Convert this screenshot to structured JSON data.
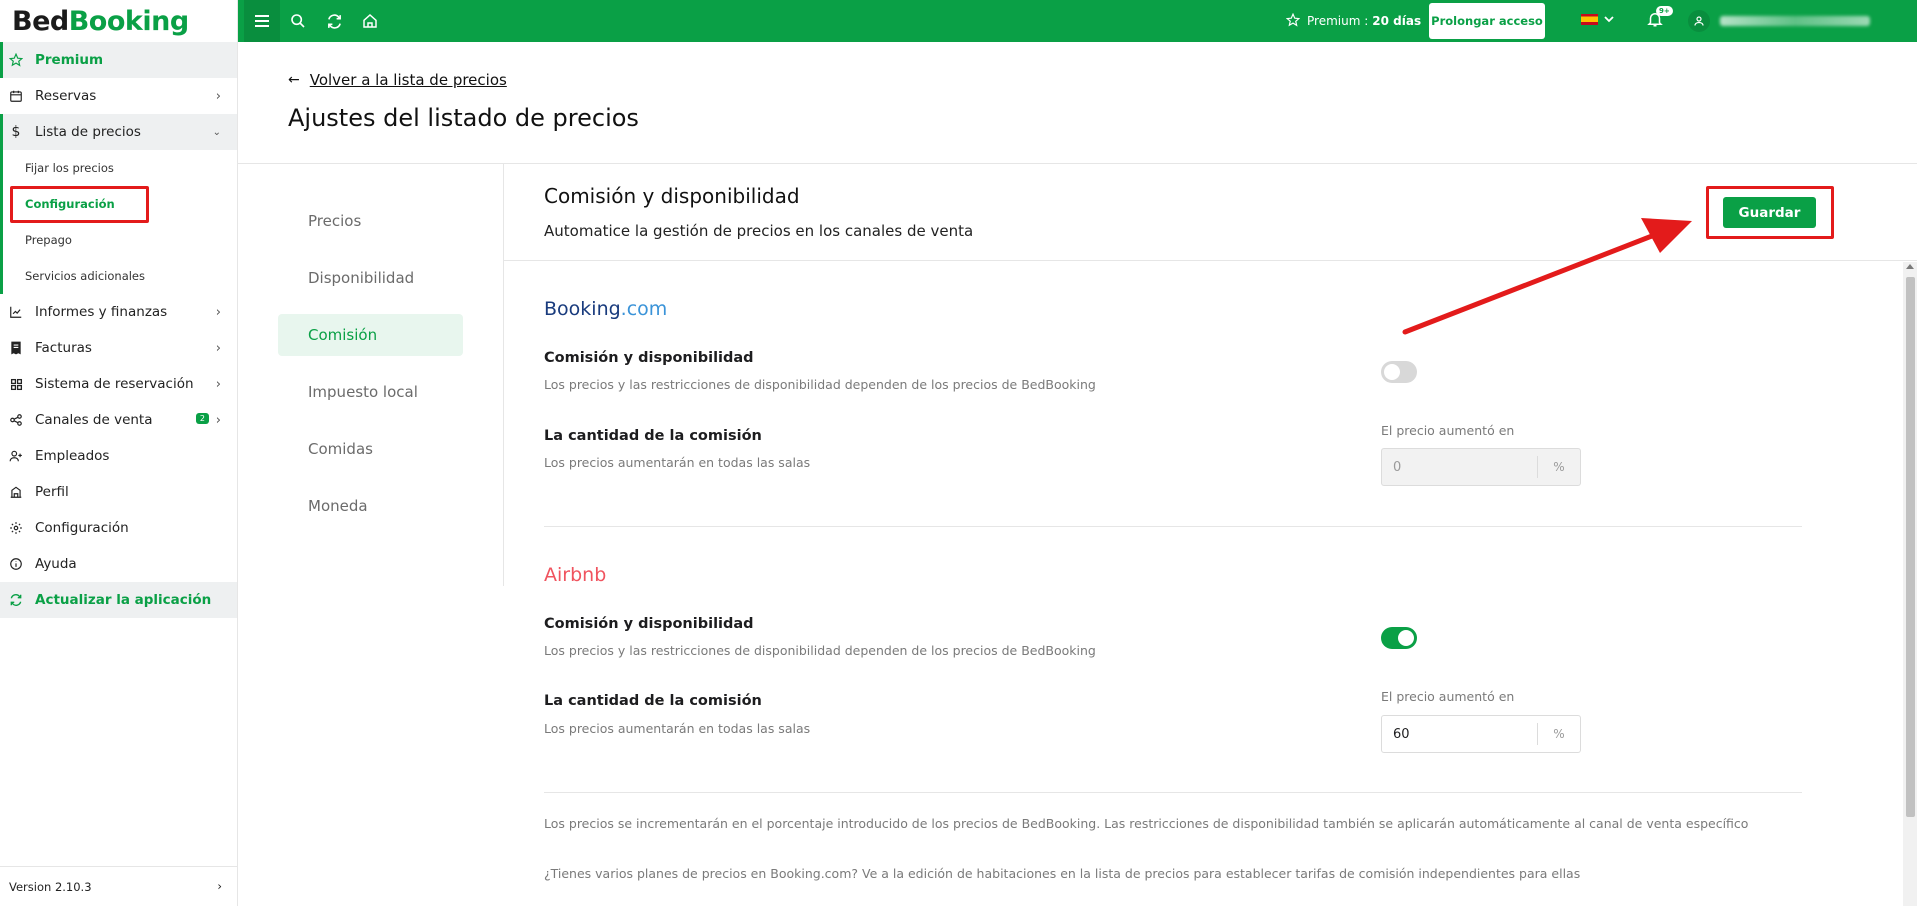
{
  "app": {
    "logo_part1": "Bed",
    "logo_part2": "Booking"
  },
  "sidebar": {
    "premium": "Premium",
    "reservas": "Reservas",
    "lista_precios": "Lista de precios",
    "sub_items": [
      "Fijar los precios",
      "Configuración",
      "Prepago",
      "Servicios adicionales"
    ],
    "informes": "Informes y finanzas",
    "facturas": "Facturas",
    "sistema": "Sistema de reservación",
    "canales": "Canales de venta",
    "canales_badge": "2",
    "empleados": "Empleados",
    "perfil": "Perfil",
    "configuracion": "Configuración",
    "ayuda": "Ayuda",
    "actualizar": "Actualizar la aplicación",
    "version": "Version 2.10.3"
  },
  "topbar": {
    "premium_label": "Premium :",
    "premium_days": "20 días",
    "prolong_button": "Prolongar acceso",
    "bell_badge": "9+"
  },
  "header": {
    "back_link": "Volver a la lista de precios",
    "title": "Ajustes del listado de precios"
  },
  "tabs": [
    "Precios",
    "Disponibilidad",
    "Comisión",
    "Impuesto local",
    "Comidas",
    "Moneda"
  ],
  "content": {
    "title": "Comisión y disponibilidad",
    "subtitle": "Automatice la gestión de precios en los canales de venta",
    "save_button": "Guardar"
  },
  "channels": {
    "booking": {
      "name_part1": "Booking",
      "name_part2": ".com",
      "toggle_title": "Comisión y disponibilidad",
      "toggle_desc": "Los precios y las restricciones de disponibilidad dependen de los precios de BedBooking",
      "toggle_on": false,
      "commission_title": "La cantidad de la comisión",
      "commission_desc": "Los precios aumentarán en todas las salas",
      "field_label": "El precio aumentó en",
      "field_value": "0",
      "field_unit": "%"
    },
    "airbnb": {
      "name": "Airbnb",
      "toggle_title": "Comisión y disponibilidad",
      "toggle_desc": "Los precios y las restricciones de disponibilidad dependen de los precios de BedBooking",
      "toggle_on": true,
      "commission_title": "La cantidad de la comisión",
      "commission_desc": "Los precios aumentarán en todas las salas",
      "field_label": "El precio aumentó en",
      "field_value": "60",
      "field_unit": "%"
    }
  },
  "footnotes": [
    "Los precios se incrementarán en el porcentaje introducido de los precios de BedBooking. Las restricciones de disponibilidad también se aplicarán automáticamente al canal de venta específico",
    "¿Tienes varios planes de precios en Booking.com? Ve a la edición de habitaciones en la lista de precios para establecer tarifas de comisión independientes para ellas"
  ],
  "colors": {
    "brand": "#0aa046",
    "annotation": "#e31b1b",
    "booking_dark": "#193b7d",
    "booking_light": "#3a93d8",
    "airbnb": "#f0545f"
  }
}
